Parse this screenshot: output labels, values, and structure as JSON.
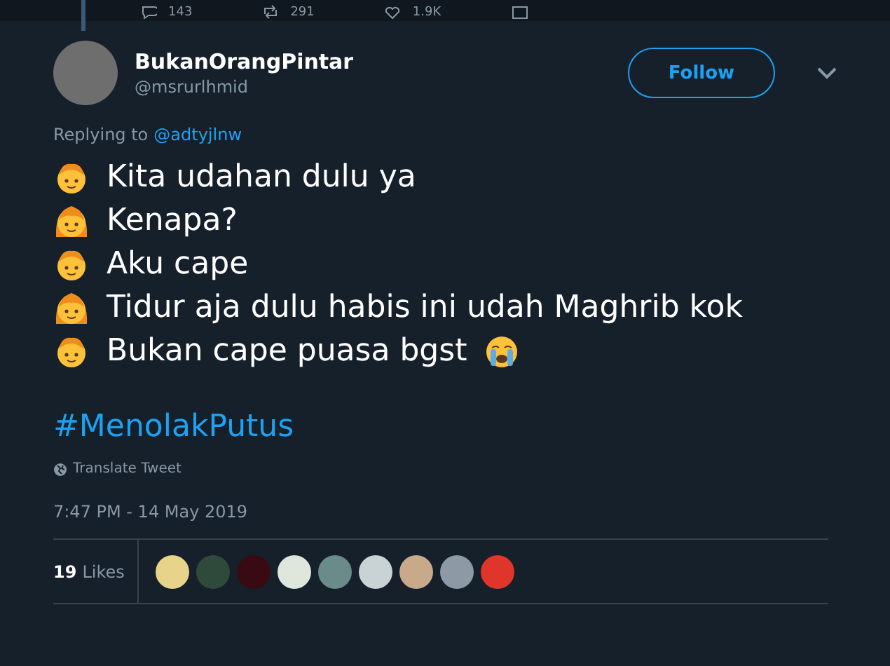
{
  "top_actions": [
    {
      "kind": "reply",
      "count": "143"
    },
    {
      "kind": "retweet",
      "count": "291"
    },
    {
      "kind": "like",
      "count": "1.9K"
    },
    {
      "kind": "message"
    }
  ],
  "tweet": {
    "display_name": "BukanOrangPintar",
    "handle": "@msrurlhmid",
    "follow_label": "Follow",
    "replying_prefix": "Replying to",
    "replying_to": "@adtyjlnw",
    "lines": [
      {
        "kind": "boy",
        "text": "Kita udahan dulu ya",
        "trailing_emoji": false
      },
      {
        "kind": "girl",
        "text": "Kenapa?",
        "trailing_emoji": false
      },
      {
        "kind": "boy",
        "text": "Aku cape",
        "trailing_emoji": false
      },
      {
        "kind": "girl",
        "text": "Tidur aja dulu habis ini udah Maghrib kok",
        "trailing_emoji": false
      },
      {
        "kind": "boy",
        "text": "Bukan cape puasa bgst",
        "trailing_emoji": true
      }
    ],
    "hashtag": "#MenolakPutus",
    "translate": "Translate Tweet",
    "timestamp": "7:47 PM - 14 May 2019",
    "likes_count": "19",
    "likes_label": "Likes",
    "likers": [
      {
        "color": "#e8d38a"
      },
      {
        "color": "#2f4a3a"
      },
      {
        "color": "#3a0a12"
      },
      {
        "color": "#dfe6dc"
      },
      {
        "color": "#6b8a8a"
      },
      {
        "color": "#c9d3d6"
      },
      {
        "color": "#c8a98a"
      },
      {
        "color": "#8d9aa6"
      },
      {
        "color": "#e0352b"
      }
    ]
  }
}
